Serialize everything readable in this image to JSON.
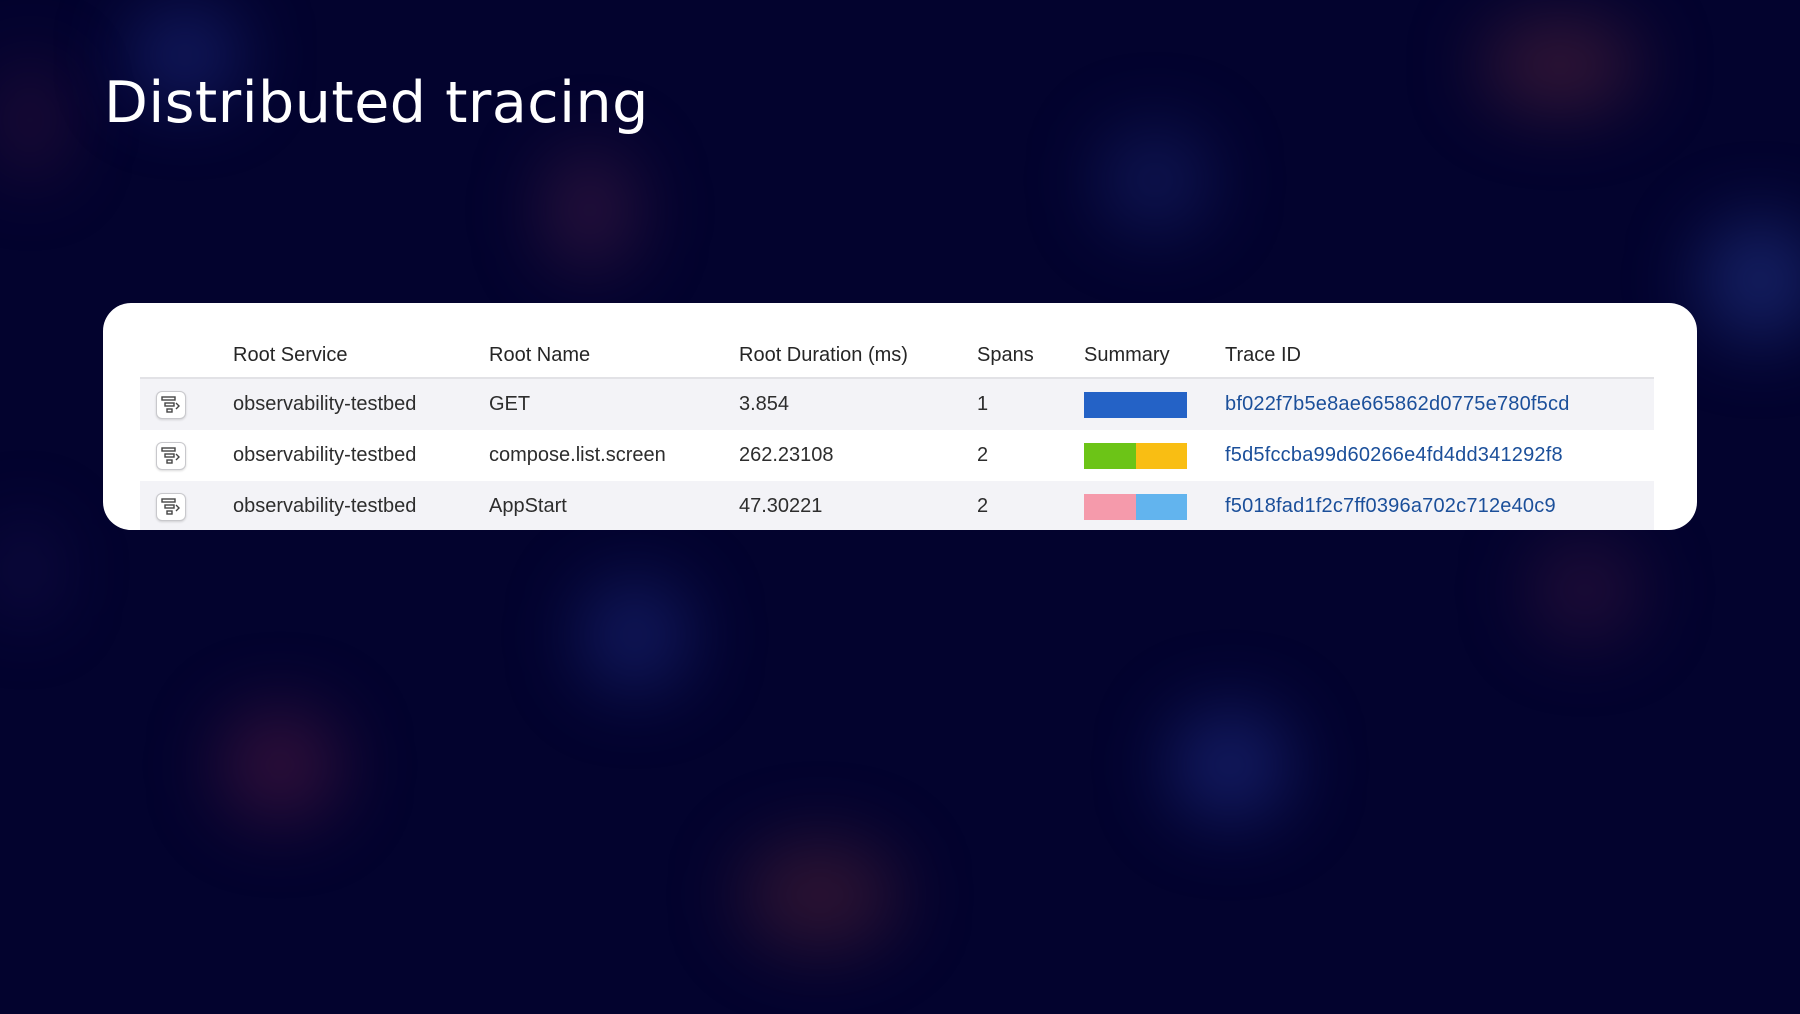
{
  "slide": {
    "title": "Distributed tracing"
  },
  "table": {
    "columns": {
      "root_service": "Root Service",
      "root_name": "Root Name",
      "root_duration": "Root Duration (ms)",
      "spans": "Spans",
      "summary": "Summary",
      "trace_id": "Trace ID"
    },
    "rows": [
      {
        "icon": "trace-view-icon",
        "root_service": "observability-testbed",
        "root_name": "GET",
        "root_duration": "3.854",
        "spans": "1",
        "summary": [
          {
            "color": "#2462c6",
            "fraction": 1.0
          }
        ],
        "trace_id": "bf022f7b5e8ae665862d0775e780f5cd"
      },
      {
        "icon": "trace-view-icon",
        "root_service": "observability-testbed",
        "root_name": "compose.list.screen",
        "root_duration": "262.23108",
        "spans": "2",
        "summary": [
          {
            "color": "#6cc417",
            "fraction": 0.5
          },
          {
            "color": "#f9be13",
            "fraction": 0.5
          }
        ],
        "trace_id": "f5d5fccba99d60266e4fd4dd341292f8"
      },
      {
        "icon": "trace-view-icon",
        "root_service": "observability-testbed",
        "root_name": "AppStart",
        "root_duration": "47.30221",
        "spans": "2",
        "summary": [
          {
            "color": "#f59aab",
            "fraction": 0.5
          },
          {
            "color": "#62b4ee",
            "fraction": 0.5
          }
        ],
        "trace_id": "f5018fad1f2c7ff0396a702c712e40c9"
      }
    ]
  },
  "colors": {
    "background": "#03032e",
    "link": "#1b4f9a"
  }
}
